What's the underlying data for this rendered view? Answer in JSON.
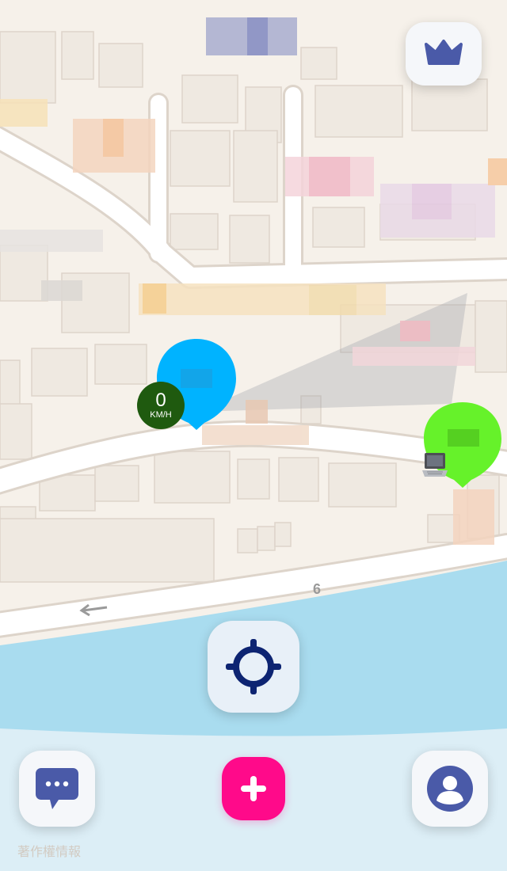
{
  "map": {
    "route_number": "6",
    "attribution": "著作權情報",
    "colors": {
      "land": "#f6f1ea",
      "water": "#a9dcef",
      "road": "#ffffff",
      "building": "#efe9e1",
      "building_outline": "#ddd4ca"
    }
  },
  "markers": {
    "self": {
      "color": "#00b3ff",
      "speed_value": "0",
      "speed_unit": "KM/H",
      "speed_badge_color": "#1f5a0f"
    },
    "friend": {
      "color": "#66f22a",
      "device_icon": "laptop-icon"
    }
  },
  "buttons": {
    "premium": {
      "icon": "crown-icon",
      "color": "#4a5aa8"
    },
    "locate": {
      "icon": "crosshair-icon",
      "color": "#0d2472"
    },
    "chat": {
      "icon": "chat-bubble-icon",
      "color": "#4a5aa8"
    },
    "add": {
      "icon": "plus-icon",
      "color": "#ff0a8a"
    },
    "profile": {
      "icon": "user-avatar-icon",
      "color": "#4a5aa8"
    }
  }
}
